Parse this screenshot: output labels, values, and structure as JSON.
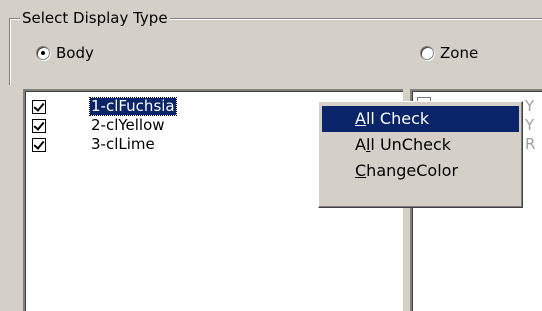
{
  "group": {
    "legend": "Select Display Type",
    "options": [
      {
        "label": "Body",
        "checked": true
      },
      {
        "label": "Zone",
        "checked": false
      }
    ]
  },
  "list": {
    "items": [
      {
        "label": "1-clFuchsia",
        "checked": true,
        "selected": true
      },
      {
        "label": "2-clYellow",
        "checked": true,
        "selected": false
      },
      {
        "label": "3-clLime",
        "checked": true,
        "selected": false
      }
    ]
  },
  "list2": {
    "items": [
      {
        "label": "Y"
      },
      {
        "label": "Y"
      },
      {
        "label": "R"
      }
    ]
  },
  "context_menu": {
    "items": [
      {
        "pre": "",
        "acc": "A",
        "post": "ll Check",
        "highlighted": true
      },
      {
        "pre": "A",
        "acc": "l",
        "post": "l UnCheck",
        "highlighted": false
      },
      {
        "pre": "",
        "acc": "C",
        "post": "hangeColor",
        "highlighted": false
      }
    ]
  },
  "colors": {
    "face": "#d4d0c8",
    "selection": "#0a246a"
  }
}
